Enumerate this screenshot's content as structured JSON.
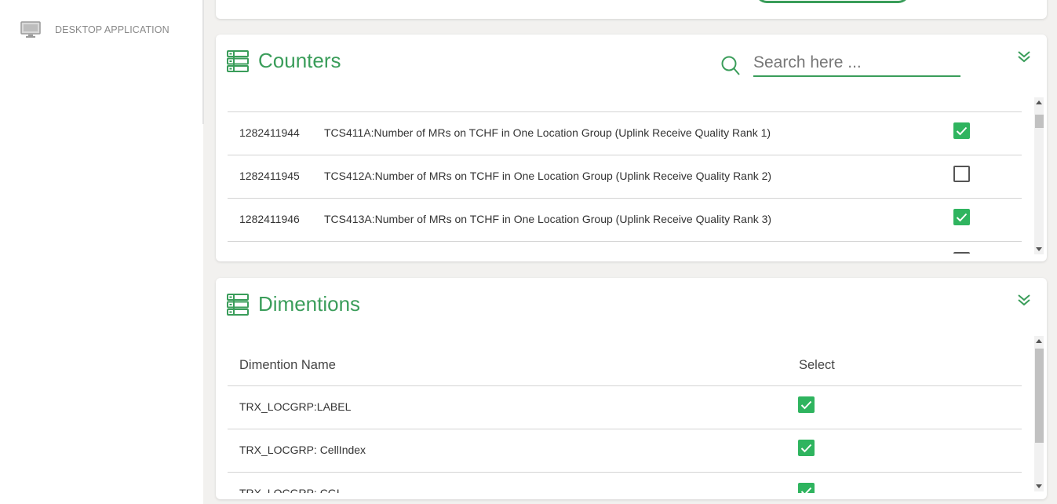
{
  "sidebar": {
    "items": [
      {
        "label": "DESKTOP APPLICATION",
        "icon": "monitor-icon"
      }
    ]
  },
  "colors": {
    "accent": "#3a9d5a",
    "checkbox_checked": "#2fb45f"
  },
  "counters": {
    "title": "Counters",
    "search_placeholder": "Search here ...",
    "rows": [
      {
        "id": "1282411944",
        "name": "TCS411A:Number of MRs on TCHF in One Location Group (Uplink Receive Quality Rank 1)",
        "checked": true
      },
      {
        "id": "1282411945",
        "name": "TCS412A:Number of MRs on TCHF in One Location Group (Uplink Receive Quality Rank 2)",
        "checked": false
      },
      {
        "id": "1282411946",
        "name": "TCS413A:Number of MRs on TCHF in One Location Group (Uplink Receive Quality Rank 3)",
        "checked": true
      },
      {
        "id": "",
        "name": "",
        "checked": false
      }
    ]
  },
  "dimentions": {
    "title": "Dimentions",
    "columns": {
      "name": "Dimention Name",
      "select": "Select"
    },
    "rows": [
      {
        "name": "TRX_LOCGRP:LABEL",
        "checked": true
      },
      {
        "name": "TRX_LOCGRP: CellIndex",
        "checked": true
      },
      {
        "name": "TRX_LOCGRP: CGI",
        "checked": true
      }
    ]
  }
}
